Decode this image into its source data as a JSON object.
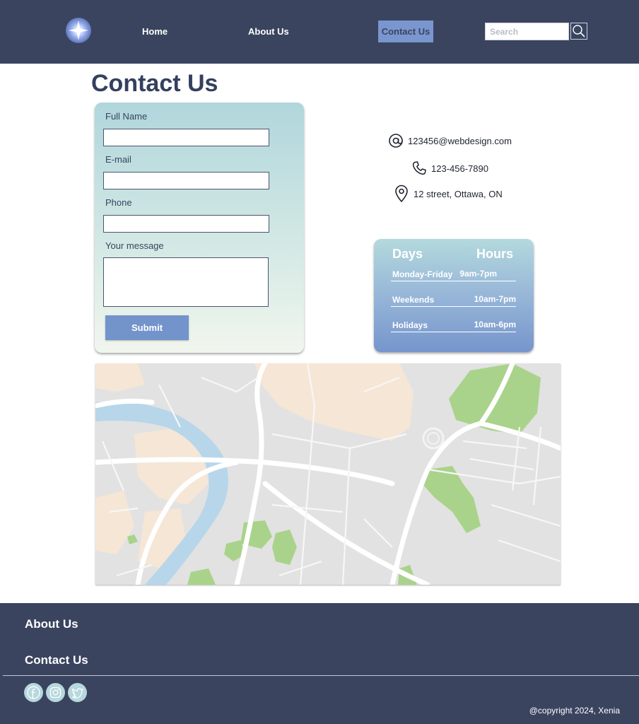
{
  "header": {
    "nav": {
      "home": "Home",
      "about": "About Us",
      "contact": "Contact Us"
    },
    "search": {
      "placeholder": "Search"
    }
  },
  "page": {
    "title": "Contact Us"
  },
  "form": {
    "full_name_label": "Full Name",
    "email_label": "E-mail",
    "phone_label": "Phone",
    "message_label": "Your message",
    "submit_label": "Submit"
  },
  "contact_info": {
    "email": "123456@webdesign.com",
    "phone": "123-456-7890",
    "address": "12 street, Ottawa, ON"
  },
  "hours": {
    "days_header": "Days",
    "hours_header": "Hours",
    "rows": [
      {
        "day": "Monday-Friday",
        "time": "9am-7pm"
      },
      {
        "day": "Weekends",
        "time": "10am-7pm"
      },
      {
        "day": "Holidays",
        "time": "10am-6pm"
      }
    ]
  },
  "footer": {
    "about_link": "About Us",
    "contact_link": "Contact Us",
    "copyright": "@copyright 2024, Xenia"
  },
  "colors": {
    "navy": "#3a445f",
    "accent_blue": "#7a96cf",
    "teal_light": "#b0d6dc",
    "social_bg": "#b7d8dd"
  },
  "icons": {
    "logo": "star-sparkle-icon",
    "search": "magnifier-icon",
    "email": "at-sign-icon",
    "phone": "phone-icon",
    "address": "location-pin-icon",
    "social": [
      "facebook-icon",
      "instagram-icon",
      "twitter-icon"
    ]
  }
}
